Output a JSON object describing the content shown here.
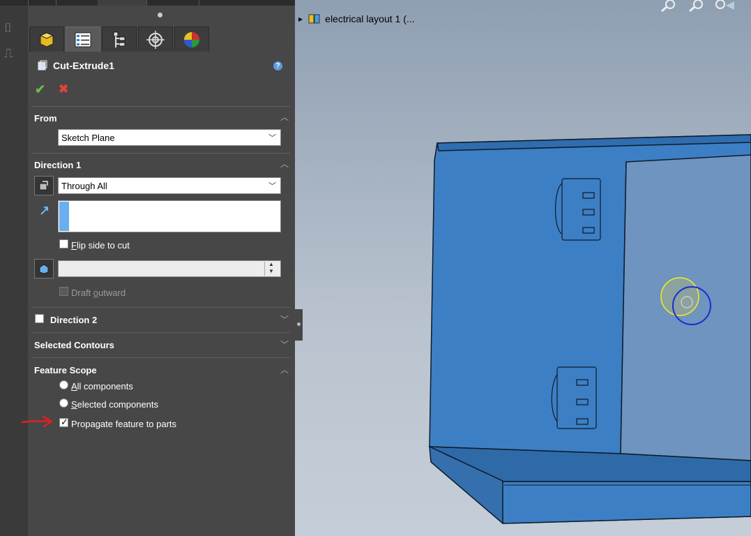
{
  "feature": {
    "title": "Cut-Extrude1",
    "help_label": "?"
  },
  "actions": {
    "ok_glyph": "✔",
    "cancel_glyph": "✖"
  },
  "tabs": [
    {
      "icon": "feature-manager-icon",
      "active": false
    },
    {
      "icon": "property-manager-icon",
      "active": true
    },
    {
      "icon": "configuration-manager-icon",
      "active": false
    },
    {
      "icon": "dimxpert-manager-icon",
      "active": false
    },
    {
      "icon": "display-manager-icon",
      "active": false
    }
  ],
  "from": {
    "title": "From",
    "value": "Sketch Plane"
  },
  "direction1": {
    "title": "Direction 1",
    "end_condition": "Through All",
    "flip_label_accel": "F",
    "flip_label_rest": "lip side to cut",
    "flip_checked": false,
    "draft_label_prefix": "Draft ",
    "draft_label_accel": "o",
    "draft_label_rest": "utward",
    "draft_checked": false
  },
  "direction2": {
    "title": "Direction 2",
    "checked": false
  },
  "selected_contours": {
    "title": "Selected Contours"
  },
  "feature_scope": {
    "title": "Feature Scope",
    "all_accel": "A",
    "all_rest": "ll components",
    "selected_accel": "S",
    "selected_rest": "elected components",
    "propagate_label": "Propagate feature to parts",
    "propagate_checked": true
  },
  "tree": {
    "label": "electrical layout 1  (..."
  },
  "colors": {
    "panel_bg": "#474747",
    "part_blue": "#3d7fc4",
    "annotation_red": "#e02020"
  }
}
